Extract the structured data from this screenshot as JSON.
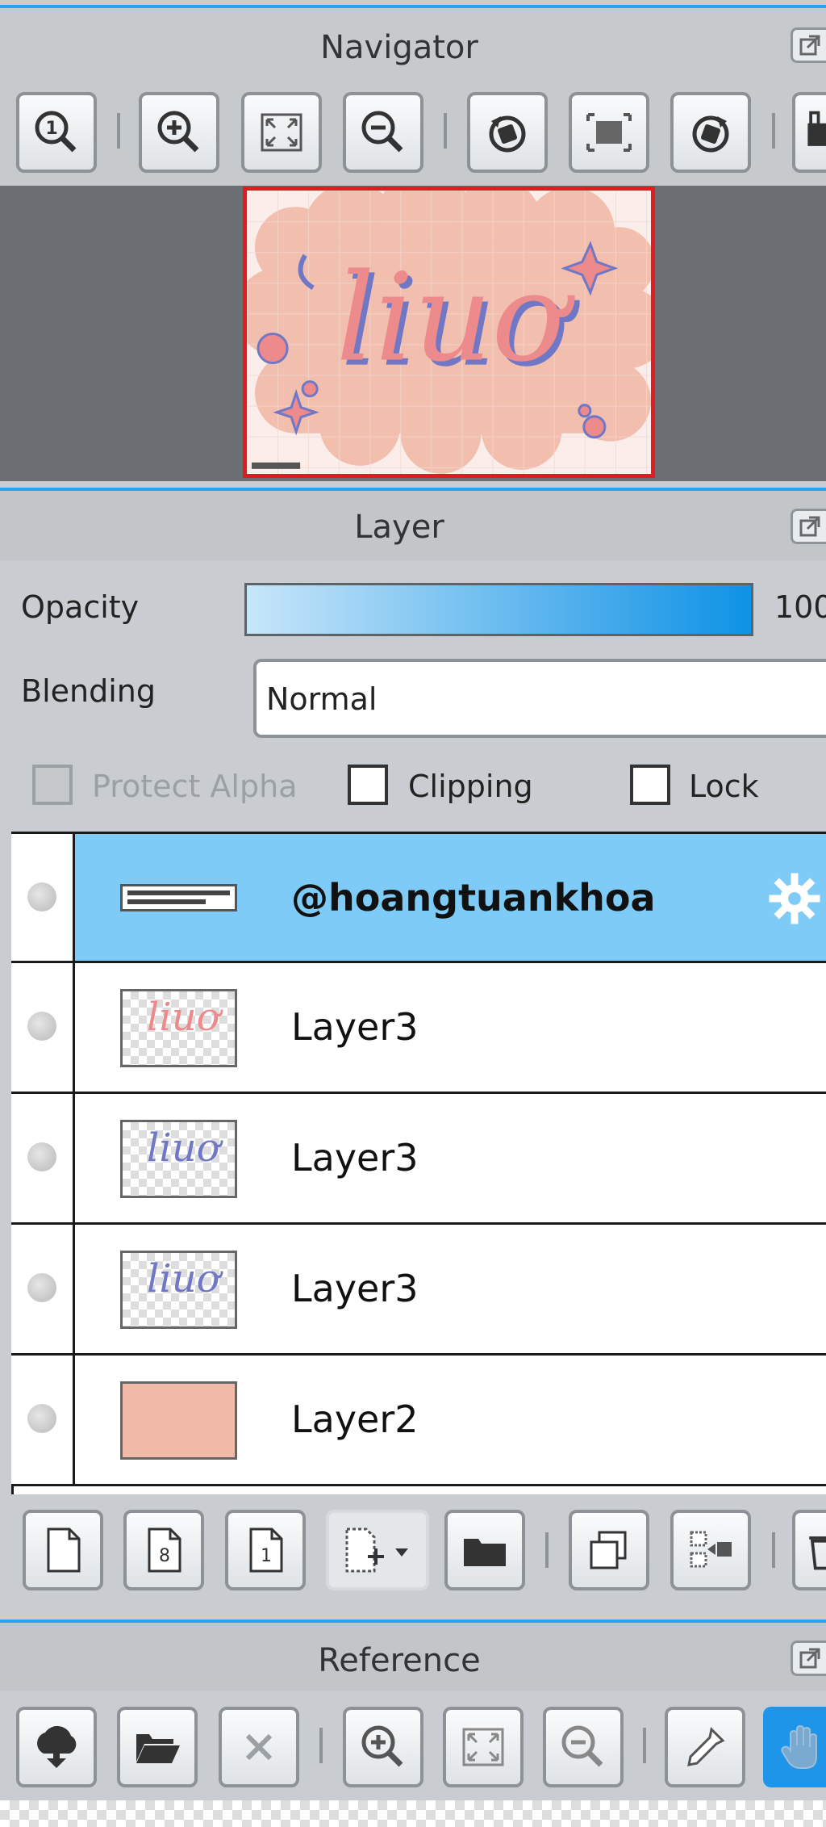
{
  "navigator": {
    "title": "Navigator",
    "tools": [
      {
        "icon": "zoom-actual-size-icon"
      },
      {
        "icon": "zoom-in-icon"
      },
      {
        "icon": "fit-to-window-icon"
      },
      {
        "icon": "zoom-out-icon"
      },
      {
        "icon": "rotate-left-icon"
      },
      {
        "icon": "reset-view-icon"
      },
      {
        "icon": "rotate-right-icon"
      },
      {
        "icon": "flip-icon"
      }
    ],
    "preview_text": "liuơ"
  },
  "layer": {
    "title": "Layer",
    "opacity_label": "Opacity",
    "opacity_value": "100",
    "opacity_fraction": 1.0,
    "blending_label": "Blending",
    "blending_value": "Normal",
    "protect_alpha_label": "Protect Alpha",
    "clipping_label": "Clipping",
    "lock_label": "Lock",
    "layers": [
      {
        "name": "@hoangtuankhoa",
        "selected": true,
        "has_settings": true,
        "thumb": "text"
      },
      {
        "name": "Layer3",
        "selected": false,
        "thumb": "pink"
      },
      {
        "name": "Layer3",
        "selected": false,
        "thumb": "blue"
      },
      {
        "name": "Layer3",
        "selected": false,
        "thumb": "blue"
      },
      {
        "name": "Layer2",
        "selected": false,
        "thumb": "fill"
      }
    ],
    "actions": [
      {
        "icon": "new-layer-icon"
      },
      {
        "icon": "new-8bit-layer-icon"
      },
      {
        "icon": "new-1bit-layer-icon"
      },
      {
        "icon": "add-layer-menu-icon"
      },
      {
        "icon": "new-folder-icon"
      },
      {
        "icon": "duplicate-layer-icon"
      },
      {
        "icon": "merge-down-icon"
      },
      {
        "icon": "delete-layer-icon"
      }
    ]
  },
  "reference": {
    "title": "Reference",
    "tools": [
      {
        "icon": "import-icon"
      },
      {
        "icon": "open-folder-icon"
      },
      {
        "icon": "close-icon"
      },
      {
        "icon": "zoom-in-icon"
      },
      {
        "icon": "fit-to-window-icon"
      },
      {
        "icon": "zoom-out-icon"
      },
      {
        "icon": "eyedropper-icon"
      },
      {
        "icon": "hand-icon"
      }
    ]
  },
  "colors": {
    "accent": "#29a3ec",
    "selection": "#7dcbf6",
    "nav_frame": "#e11b22",
    "preview_bg": "#f2bfae",
    "text_pink": "#ec8a8c",
    "text_blue": "#7077c4"
  }
}
